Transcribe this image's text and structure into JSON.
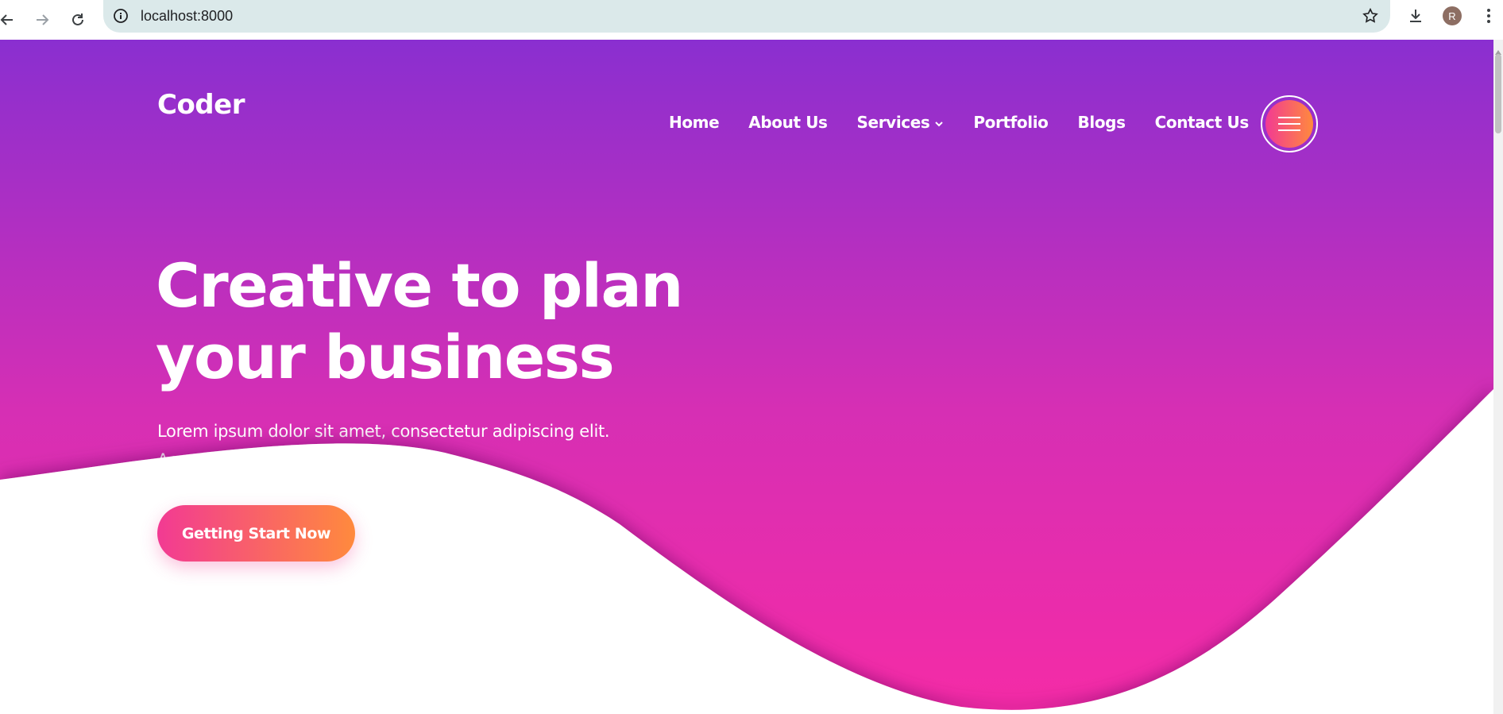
{
  "browser": {
    "url": "localhost:8000",
    "profile_initial": "R",
    "icons": [
      "back-arrow-icon",
      "forward-arrow-icon",
      "reload-icon",
      "site-info-icon",
      "bookmark-star-icon",
      "download-icon",
      "kebab-menu-icon"
    ]
  },
  "page": {
    "brand": "Coder",
    "nav": {
      "home": "Home",
      "about": "About Us",
      "services": "Services",
      "portfolio": "Portfolio",
      "blogs": "Blogs",
      "contact": "Contact Us"
    },
    "hero": {
      "title_line1": "Creative to plan",
      "title_line2": "your business",
      "lede": "Lorem ipsum dolor sit amet, consectetur adipiscing elit. Aenean condimentum orci in",
      "cta": "Getting Start Now"
    }
  },
  "colors": {
    "hero_top": "#8a2fd0",
    "hero_bottom": "#f52ba6",
    "accent_pink": "#f23a93",
    "accent_orange": "#ff8a3d"
  }
}
